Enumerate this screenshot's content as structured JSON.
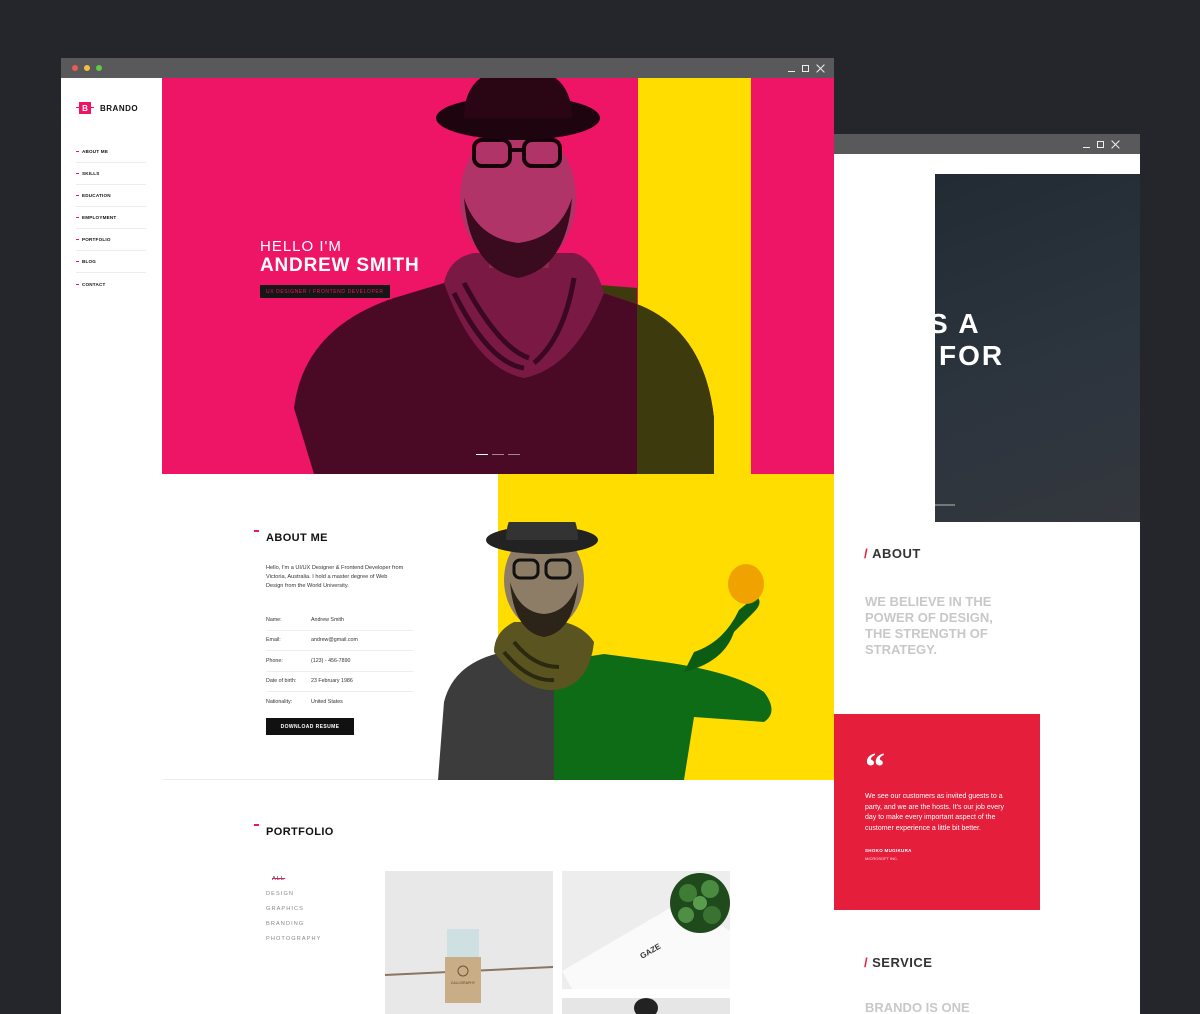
{
  "back_window": {
    "hero_line1": "S A",
    "hero_line2": "FOR",
    "about_title": "ABOUT",
    "about_slash": "/",
    "believe": "WE BELIEVE IN THE POWER OF DESIGN, THE STRENGTH OF STRATEGY.",
    "quote_mark": "“",
    "quote": "We see our customers as invited guests to a party, and we are the hosts. It's our job every day to make every important aspect of the customer experience a little bit better.",
    "quote_author": "SHOKO MUGIKURA",
    "quote_company": "MICROSOFT INC.",
    "service_title": "SERVICE",
    "service_slash": "/",
    "service_text": "BRANDO IS ONE",
    "accent": "#e41e3b"
  },
  "front_window": {
    "traffic_lights": [
      "#ee5a52",
      "#f5bf3e",
      "#5fcb45"
    ],
    "brand": "BRANDO",
    "logo_letter": "B",
    "nav": [
      "ABOUT ME",
      "SKILLS",
      "EDUCATION",
      "EMPLOYMENT",
      "PORTFOLIO",
      "BLOG",
      "CONTACT"
    ],
    "hero": {
      "hello": "HELLO I'M",
      "name": "ANDREW SMITH",
      "role": "UX DESIGNER / FRONTEND DEVELOPER",
      "slides_total": 3,
      "slide_active": 1
    },
    "about": {
      "title": "ABOUT ME",
      "text": "Hello, I'm a UI/UX Designer & Frontend Developer from Victoria, Australia. I hold a master degree of Web Design from the World University.",
      "info": [
        {
          "label": "Name:",
          "value": "Andrew Smith"
        },
        {
          "label": "Email:",
          "value": "andrew@gmail.com"
        },
        {
          "label": "Phone:",
          "value": "(123) - 456-7890"
        },
        {
          "label": "Date of birth:",
          "value": "23 February 1986"
        },
        {
          "label": "Nationality:",
          "value": "United States"
        }
      ],
      "button": "DOWNLOAD RESUME"
    },
    "portfolio": {
      "title": "PORTFOLIO",
      "filters": [
        "ALL",
        "DESIGN",
        "GRAPHICS",
        "BRANDING",
        "PHOTOGRAPHY"
      ],
      "active_filter": "ALL",
      "thumb_box_label": "CALLIGRAPHY",
      "thumb_card_label": "GAZE"
    },
    "colors": {
      "pink": "#ee1466",
      "yellow": "#ffdd00",
      "green": "#0e6b16"
    }
  }
}
